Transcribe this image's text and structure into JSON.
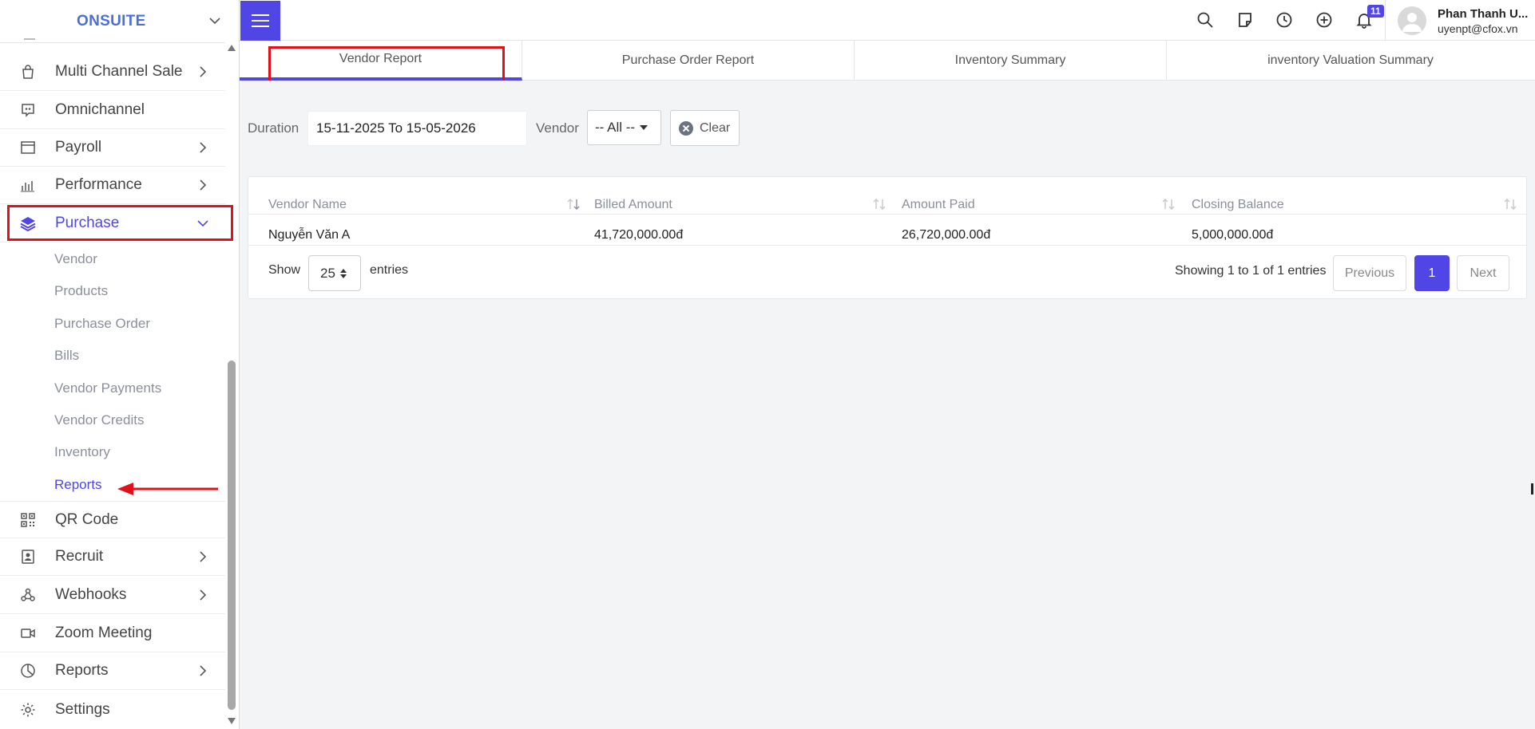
{
  "sidebar": {
    "brand": "ONSUITE",
    "items": [
      {
        "label": "Multi Channel Sale"
      },
      {
        "label": "Omnichannel"
      },
      {
        "label": "Payroll"
      },
      {
        "label": "Performance"
      },
      {
        "label": "Purchase"
      },
      {
        "label": "QR Code"
      },
      {
        "label": "Recruit"
      },
      {
        "label": "Webhooks"
      },
      {
        "label": "Zoom Meeting"
      },
      {
        "label": "Reports"
      },
      {
        "label": "Settings"
      }
    ],
    "purchase_subitems": [
      {
        "label": "Vendor"
      },
      {
        "label": "Products"
      },
      {
        "label": "Purchase Order"
      },
      {
        "label": "Bills"
      },
      {
        "label": "Vendor Payments"
      },
      {
        "label": "Vendor Credits"
      },
      {
        "label": "Inventory"
      },
      {
        "label": "Reports"
      }
    ]
  },
  "header": {
    "notification_count": "11",
    "user_name": "Phan Thanh U...",
    "user_email": "uyenpt@cfox.vn"
  },
  "tabs": [
    {
      "label": "Vendor Report"
    },
    {
      "label": "Purchase Order Report"
    },
    {
      "label": "Inventory Summary"
    },
    {
      "label": "inventory Valuation Summary"
    }
  ],
  "filters": {
    "duration_label": "Duration",
    "duration_value": "15-11-2025 To 15-05-2026",
    "vendor_label": "Vendor",
    "vendor_value": "-- All --",
    "clear_label": "Clear"
  },
  "table": {
    "columns": [
      "Vendor Name",
      "Billed Amount",
      "Amount Paid",
      "Closing Balance"
    ],
    "rows": [
      [
        "Nguyễn Văn A",
        "41,720,000.00đ",
        "26,720,000.00đ",
        "5,000,000.00đ"
      ]
    ],
    "show_label": "Show",
    "page_size": "25",
    "entries_label": "entries",
    "info": "Showing 1 to 1 of 1 entries",
    "previous_label": "Previous",
    "current_page": "1",
    "next_label": "Next"
  },
  "colors": {
    "accent": "#4f46e5",
    "annotation": "#e3101a",
    "brand": "#4a6fd6"
  }
}
